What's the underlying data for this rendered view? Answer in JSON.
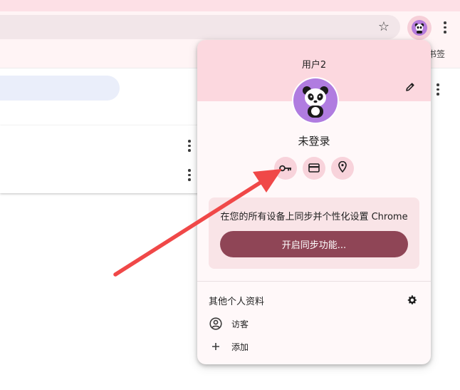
{
  "toolbar": {
    "bookmark_label": "书签"
  },
  "profile_menu": {
    "profile_name": "用户2",
    "signin_status": "未登录",
    "quick_actions": [
      {
        "icon": "key-icon"
      },
      {
        "icon": "credit-card-icon"
      },
      {
        "icon": "location-pin-icon"
      }
    ],
    "sync_promo": {
      "text": "在您的所有设备上同步并个性化设置 Chrome",
      "button_label": "开启同步功能..."
    },
    "other_profiles": {
      "title": "其他个人资料",
      "items": [
        {
          "icon": "person-circle-icon",
          "label": "访客"
        },
        {
          "icon": "plus-icon",
          "label": "添加"
        }
      ]
    }
  },
  "colors": {
    "header_pink": "#fcd8df",
    "sync_button": "#8f4556",
    "avatar_purple": "#b07ce0",
    "arrow_red": "#f04848"
  }
}
